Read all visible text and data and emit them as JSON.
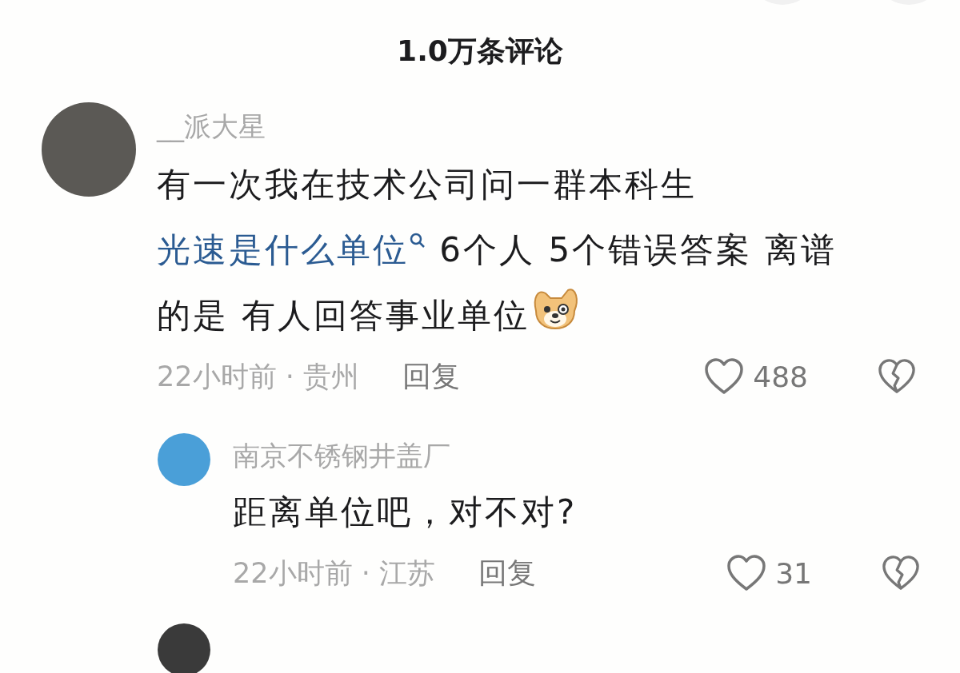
{
  "header": {
    "title": "1.0万条评论"
  },
  "comments": [
    {
      "author": "__派大星",
      "segments": [
        {
          "kind": "text",
          "text": "有一次我在技术公司问一群本科生"
        },
        {
          "kind": "break"
        },
        {
          "kind": "link",
          "text": "光速是什么单位"
        },
        {
          "kind": "text",
          "text": " 6个人 5个错误答案 离谱的是 有人回答事业单位"
        },
        {
          "kind": "sticker"
        }
      ],
      "time": "22小时前 · 贵州",
      "reply": "回复",
      "likes": "488",
      "liked": false,
      "replies": [
        {
          "author": "南京不锈钢井盖厂",
          "segments": [
            {
              "kind": "text",
              "text": "距离单位吧，对不对?"
            }
          ],
          "time": "22小时前 · 江苏",
          "reply": "回复",
          "likes": "31",
          "liked": false
        }
      ]
    }
  ]
}
